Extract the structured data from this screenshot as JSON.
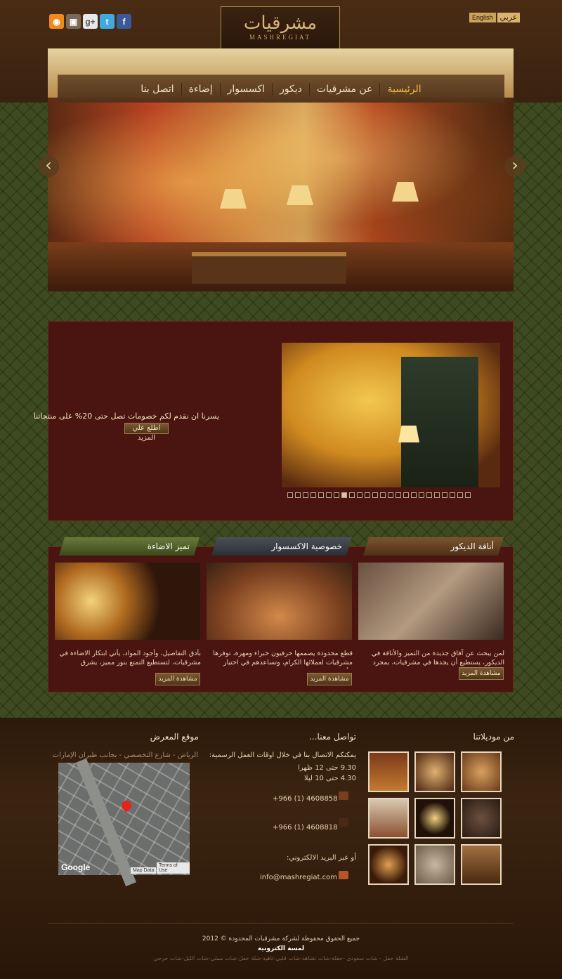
{
  "header": {
    "logo_ar": "مشرقيات",
    "logo_en": "MASHREGIAT",
    "lang_en": "English",
    "lang_ar": "عربي",
    "social": [
      "rss-icon",
      "instagram-icon",
      "google-plus-icon",
      "twitter-icon",
      "facebook-icon"
    ]
  },
  "nav": {
    "items": [
      "الرئيسية",
      "عن مشرقيات",
      "ديكور",
      "اكسسوار",
      "إضاءة",
      "اتصل بنا"
    ]
  },
  "hero": {
    "prev": "‹",
    "next": "›"
  },
  "promo": {
    "text": "يسرنا ان نقدم لكم خصومات تصل حتى 20% على منتجاتنا",
    "button": "اطلع علي المزيد",
    "dots_count": 24,
    "active_dot": 8
  },
  "features": [
    {
      "title": "أناقة الديكور",
      "text": "لمن يبحث عن آفاق جديدة من التميز والأناقة في الديكور، يستطيع أن يجدها في مشرقيات، بمجرد زيارة واحدة.",
      "button": "مشاهدة المزيد"
    },
    {
      "title": "خصوصية الاكسسوار",
      "text": "قطع محدودة يصممها حرفيون خبراء ومهرة، توفرها مشرقيات لعملائها الكرام، وتساعدهم في اختيار الأنسب لهم..",
      "button": "مشاهدة المزيد"
    },
    {
      "title": "تميز الاضاءة",
      "text": "بأدق التفاصيل، وأجود المواد، يأتي ابتكار الاضاءة في مشرقيات، لتستطيع التمتع بنور مميز، يشرق بالجمال..",
      "button": "مشاهدة المزيد"
    }
  ],
  "footer": {
    "models_title": "من موديلاتنا",
    "contact_title": "تواصل معنا...",
    "contact_intro": "يمكنكم الاتصال بنا في خلال اوقات العمل الرسمية:",
    "hours1": "9.30 حتى 12 ظهرا",
    "hours2": "4.30 حتى 10 ليلا",
    "phone1": "+966 (1) 4608858",
    "phone2": "+966 (1) 4608818",
    "email_label": "أو عبر البريد الالكتروني:",
    "email": "info@mashregiat.com",
    "location_title": "موقع المعرض",
    "address": "الرياض - شارع التخصصي - بجانب طيران الإمارات",
    "map_google": "Google",
    "map_data": "Map Data",
    "map_terms": "Terms of Use",
    "copyright": "جميع الحقوق محفوظة لشركة مشرقيات المحدودة © 2012",
    "brand": "لمسة الكترونية",
    "tags": "الشلة حفل - شات سعودي -حفلة-شات تشاهد-شات قلبي-تاهيد-شلة حفل-شات مملي-شات الليل-شات جرحي"
  },
  "colors": {
    "accent": "#f2c03a",
    "panel": "#4a1410"
  }
}
